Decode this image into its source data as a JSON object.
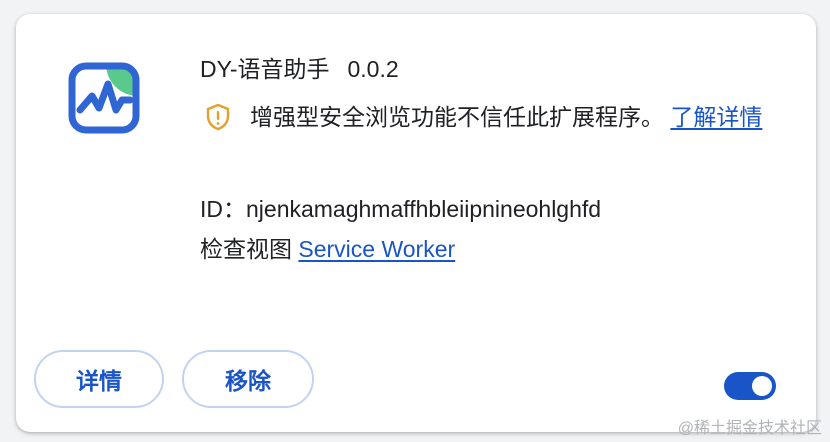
{
  "extension": {
    "name": "DY-语音助手",
    "version": "0.0.2",
    "icon": "chart-line-icon",
    "warning_icon": "shield-warning-icon",
    "warning_text": "增强型安全浏览功能不信任此扩展程序。",
    "learn_more_link": "了解详情",
    "id_label": "ID：",
    "id_value": "njenkamaghmaffhbleiipnineohlghfd",
    "inspect_label": "检查视图",
    "inspect_link": "Service Worker"
  },
  "actions": {
    "details_button": "详情",
    "remove_button": "移除",
    "enabled": true
  },
  "watermark": "@稀土掘金技术社区",
  "colors": {
    "accent": "#1a55c8",
    "icon_blue": "#2f66d3",
    "icon_green": "#5cc98c",
    "warning": "#e1a12b"
  }
}
